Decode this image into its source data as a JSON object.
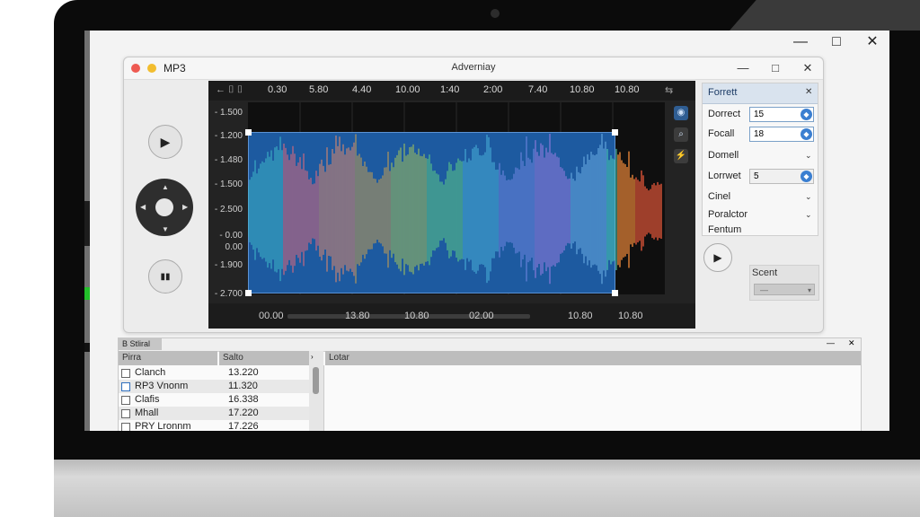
{
  "outer_window": {
    "minimize": "—",
    "maximize": "□",
    "close": "✕"
  },
  "app": {
    "app_name": "MP3",
    "window_title": "Adverniay",
    "controls": {
      "minimize": "—",
      "maximize": "□",
      "close": "✕"
    }
  },
  "left_controls": {
    "play_icon": "▶",
    "pause_icon": "▮▮"
  },
  "waveform": {
    "toolbar_left": "← ⌷ ⌷",
    "ruler_ticks": [
      "0.30",
      "5.80",
      "4.40",
      "10.00",
      "1:40",
      "2:00",
      "7.40",
      "10.80",
      "10.80"
    ],
    "ruler_right_icon": "⇆",
    "y_labels": [
      "- 1.500",
      "- 1.200",
      "- 1.480",
      "- 1.500",
      "- 2.500",
      "- 0.00",
      "- 1.900",
      "- 2.700"
    ],
    "y_mid_label": "0.00",
    "side_buttons": [
      "◉",
      "⌕",
      "⚡"
    ],
    "bottom_ticks": [
      "00.00",
      "13.80",
      "10.80",
      "02.00",
      "10.80",
      "10.80"
    ],
    "colors": {
      "selection": "#1d5aa0",
      "background": "#0f0f0f"
    }
  },
  "format_panel": {
    "title": "Forrett",
    "close": "✕",
    "rows": [
      {
        "label": "Dorrect",
        "value": "15",
        "type": "spin"
      },
      {
        "label": "Focall",
        "value": "18",
        "type": "spin"
      },
      {
        "label": "Domell",
        "value": "",
        "type": "chevron"
      },
      {
        "label": "Lorrwet",
        "value": "5",
        "type": "spin"
      },
      {
        "label": "Cinel",
        "value": "",
        "type": "chevron"
      },
      {
        "label": "Poralctor",
        "value": "",
        "type": "chevron"
      },
      {
        "label": "Fentum",
        "value": "",
        "type": "none"
      }
    ]
  },
  "right_controls": {
    "play_icon": "▶",
    "start_label": "Scent",
    "select_value": "—"
  },
  "bottom_panel": {
    "tab_label": "B Stliral",
    "col_name": "Pirra",
    "col_value": "Salto",
    "right_header": "Lotar",
    "close": "✕",
    "minimize": "—",
    "rows": [
      {
        "name": "Clanch",
        "value": "13.220"
      },
      {
        "name": "RP3 Vnonm",
        "value": "11.320"
      },
      {
        "name": "Clafis",
        "value": "16.338"
      },
      {
        "name": "Mhall",
        "value": "17.220"
      },
      {
        "name": "PRY Lronnm",
        "value": "17.226"
      }
    ]
  }
}
